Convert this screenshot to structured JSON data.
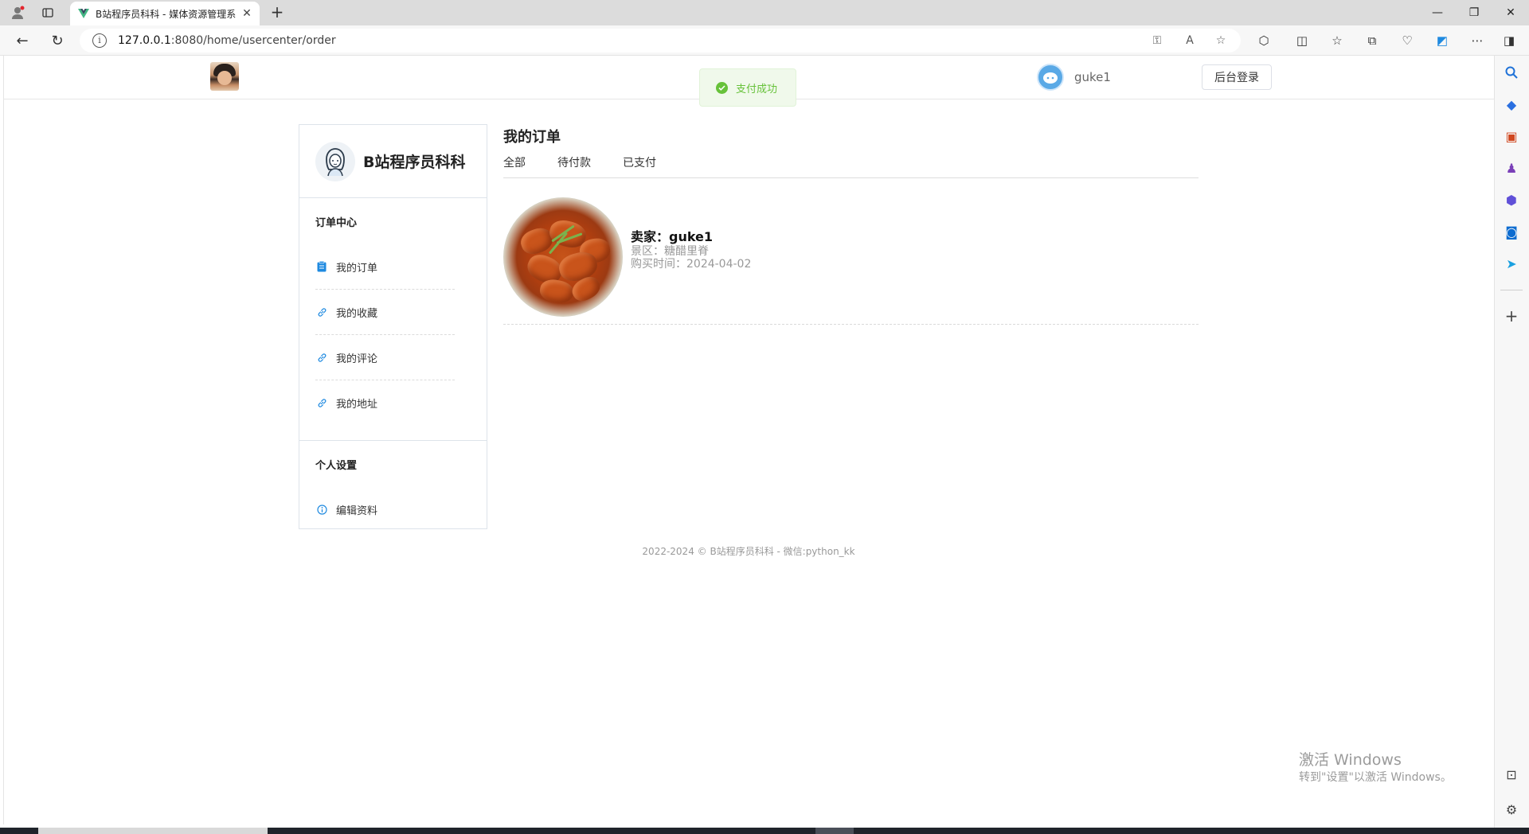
{
  "browser": {
    "tab_title": "B站程序员科科 - 媒体资源管理系",
    "url_host": "127.0.0.1",
    "url_rest": ":8080/home/usercenter/order"
  },
  "header": {
    "username": "guke1",
    "admin_login": "后台登录"
  },
  "toast": {
    "message": "支付成功",
    "color": "#67c23a"
  },
  "sidebar": {
    "brand": "B站程序员科科",
    "sections": [
      {
        "title": "订单中心",
        "items": [
          {
            "label": "我的订单",
            "icon": "clipboard-icon"
          },
          {
            "label": "我的收藏",
            "icon": "link-icon"
          },
          {
            "label": "我的评论",
            "icon": "link-icon"
          },
          {
            "label": "我的地址",
            "icon": "link-icon"
          }
        ]
      },
      {
        "title": "个人设置",
        "items": [
          {
            "label": "编辑资料",
            "icon": "info-circle-icon"
          }
        ]
      }
    ]
  },
  "main": {
    "title": "我的订单",
    "tabs": [
      "全部",
      "待付款",
      "已支付"
    ],
    "orders": [
      {
        "seller": "卖家：guke1",
        "area": "景区：糖醋里脊",
        "time": "购买时间：2024-04-02"
      }
    ]
  },
  "footer": {
    "text": "2022-2024 © B站程序员科科 - 微信:python_kk"
  },
  "watermark": {
    "title": "激活 Windows",
    "subtitle": "转到\"设置\"以激活 Windows。"
  }
}
